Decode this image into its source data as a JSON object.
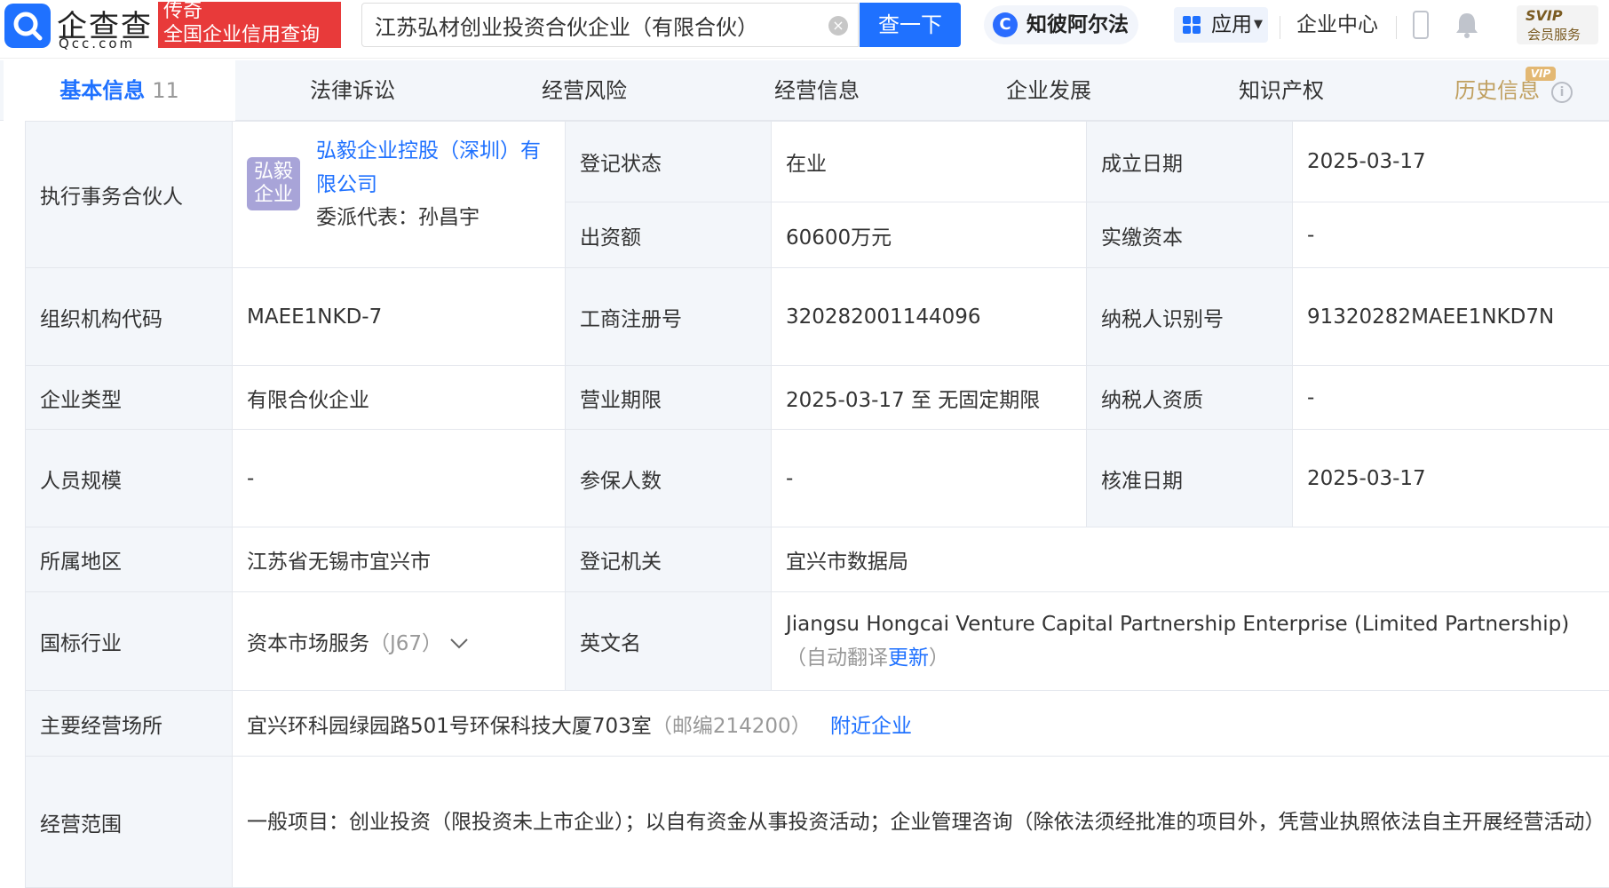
{
  "header": {
    "logo_text": "企查查",
    "logo_sub": "Qcc.com",
    "promo_line1": "传奇",
    "promo_line2": "全国企业信用查询",
    "search_value": "江苏弘材创业投资合伙企业（有限合伙）",
    "search_button": "查一下",
    "ai_button": "知彼阿尔法",
    "apps_button": "应用",
    "enterprise_center": "企业中心",
    "svip_line1": "SVIP",
    "svip_line2": "会员服务",
    "accent_color": "#1f71ff"
  },
  "tabs": [
    {
      "label": "基本信息",
      "count": "11"
    },
    {
      "label": "法律诉讼"
    },
    {
      "label": "经营风险"
    },
    {
      "label": "经营信息"
    },
    {
      "label": "企业发展"
    },
    {
      "label": "知识产权"
    },
    {
      "label": "历史信息",
      "badge": "VIP"
    }
  ],
  "info": {
    "partner_label": "执行事务合伙人",
    "partner_avatar": "弘毅企业",
    "partner_name": "弘毅企业控股（深圳）有限公司",
    "partner_rep": "委派代表：孙昌宇",
    "status_label": "登记状态",
    "status_value": "在业",
    "founded_label": "成立日期",
    "founded_value": "2025-03-17",
    "capital_label": "出资额",
    "capital_value": "60600万元",
    "paid_label": "实缴资本",
    "paid_value": "-",
    "org_code_label": "组织机构代码",
    "org_code_value": "MAEE1NKD-7",
    "reg_no_label": "工商注册号",
    "reg_no_value": "320282001144096",
    "tax_id_label": "纳税人识别号",
    "tax_id_value": "91320282MAEE1NKD7N",
    "type_label": "企业类型",
    "type_value": "有限合伙企业",
    "term_label": "营业期限",
    "term_value": "2025-03-17 至 无固定期限",
    "tax_qual_label": "纳税人资质",
    "tax_qual_value": "-",
    "staff_label": "人员规模",
    "staff_value": "-",
    "insured_label": "参保人数",
    "insured_value": "-",
    "approve_label": "核准日期",
    "approve_value": "2025-03-17",
    "region_label": "所属地区",
    "region_value": "江苏省无锡市宜兴市",
    "authority_label": "登记机关",
    "authority_value": "宜兴市数据局",
    "industry_label": "国标行业",
    "industry_value": "资本市场服务",
    "industry_code": "（J67）",
    "en_name_label": "英文名",
    "en_name_value": "Jiangsu Hongcai Venture Capital Partnership Enterprise (Limited Partnership)",
    "en_name_note_prefix": "（自动翻译",
    "en_name_update": "更新",
    "en_name_note_suffix": "）",
    "address_label": "主要经营场所",
    "address_value": "宜兴环科园绿园路501号环保科技大厦703室",
    "address_zip": "（邮编214200）",
    "nearby_link": "附近企业",
    "scope_label": "经营范围",
    "scope_value": "一般项目：创业投资（限投资未上市企业）；以自有资金从事投资活动；企业管理咨询（除依法须经批准的项目外，凭营业执照依法自主开展经营活动）"
  }
}
